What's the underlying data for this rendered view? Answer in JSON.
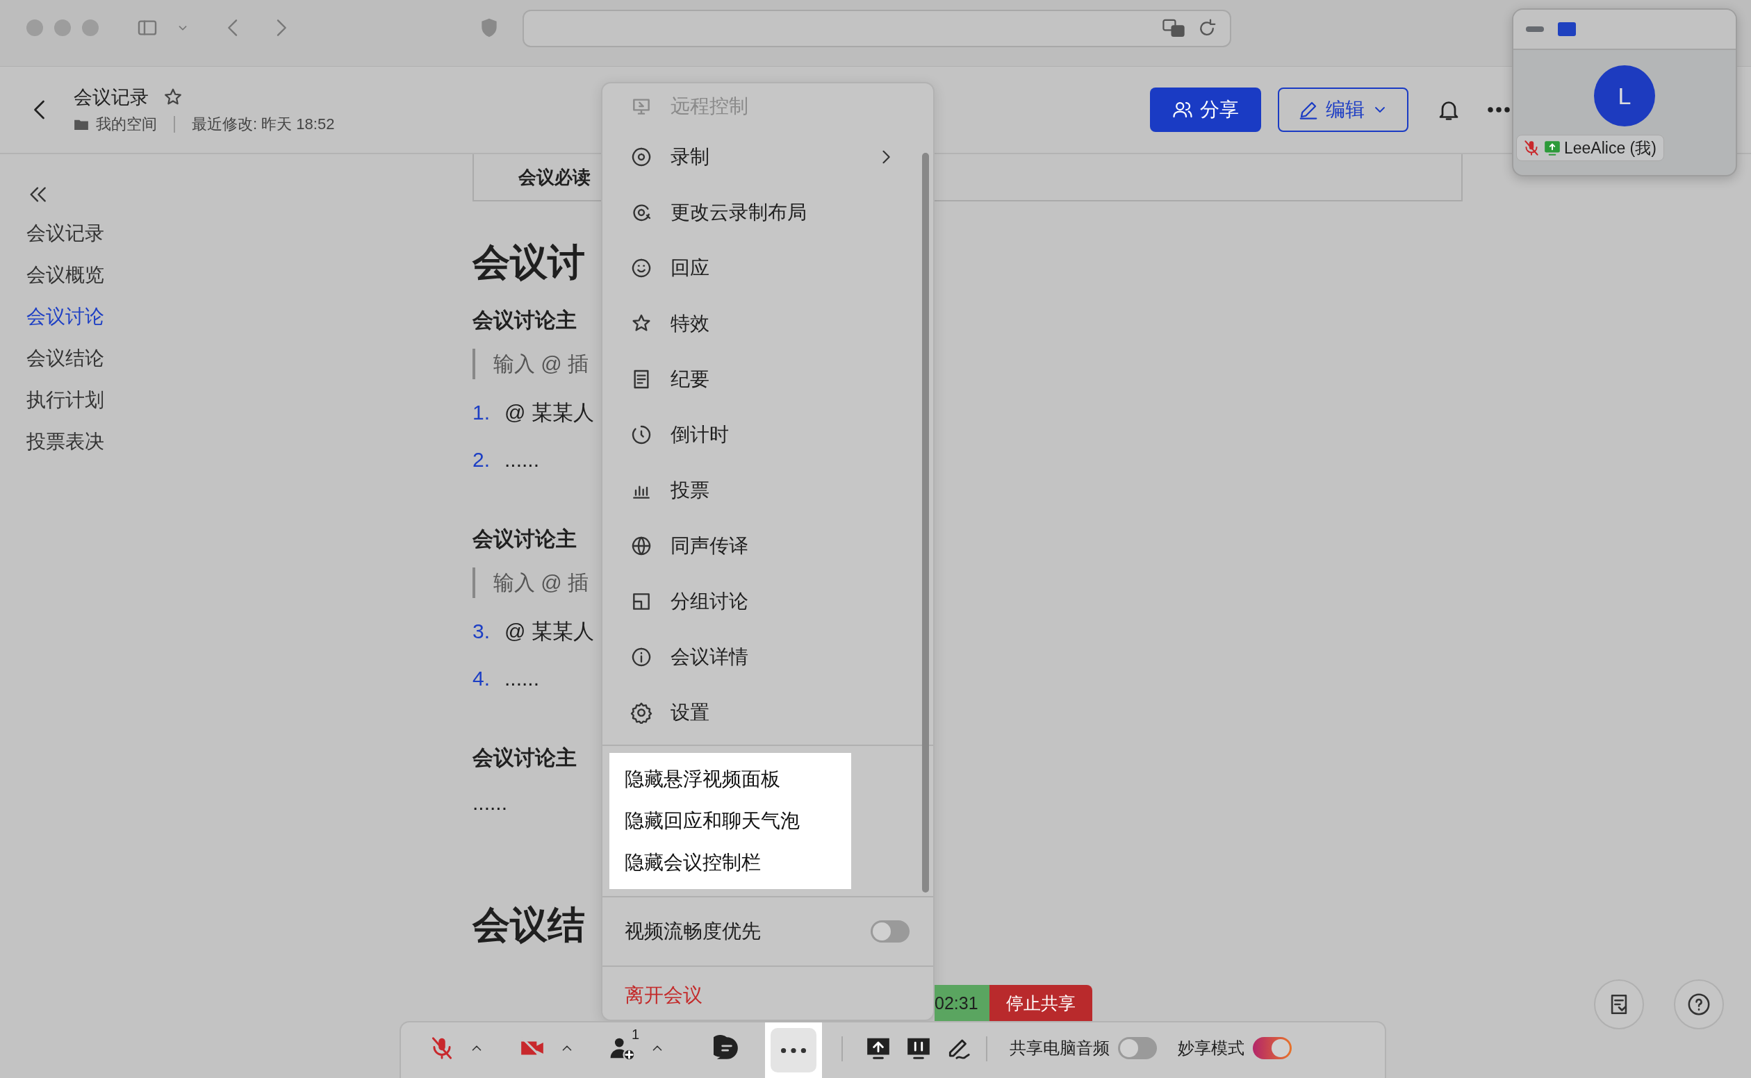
{
  "doc_header": {
    "title": "会议记录",
    "space": "我的空间",
    "modified": "最近修改: 昨天 18:52",
    "share_button": "分享",
    "edit_button": "编辑"
  },
  "outline": [
    {
      "label": "会议记录",
      "selected": false
    },
    {
      "label": "会议概览",
      "selected": false
    },
    {
      "label": "会议讨论",
      "selected": true
    },
    {
      "label": "会议结论",
      "selected": false
    },
    {
      "label": "执行计划",
      "selected": false
    },
    {
      "label": "投票表决",
      "selected": false
    }
  ],
  "document": {
    "notice": "会议必读",
    "blocks": [
      {
        "kind": "h1",
        "text": "会议讨"
      },
      {
        "kind": "h2",
        "text": "会议讨论主"
      },
      {
        "kind": "quote",
        "text": "输入 @ 插"
      },
      {
        "kind": "li",
        "number": "1.",
        "text": "@ 某某人"
      },
      {
        "kind": "li",
        "number": "2.",
        "text": "......"
      },
      {
        "kind": "h2",
        "text": "会议讨论主"
      },
      {
        "kind": "quote",
        "text": "输入 @ 插"
      },
      {
        "kind": "li",
        "number": "3.",
        "text": "@ 某某人"
      },
      {
        "kind": "li",
        "number": "4.",
        "text": "......"
      },
      {
        "kind": "h2",
        "text": "会议讨论主"
      },
      {
        "kind": "p",
        "text": "......"
      },
      {
        "kind": "h1",
        "text": "会议结"
      }
    ]
  },
  "menu": {
    "items": [
      {
        "label": "远程控制",
        "disabled": true,
        "submenu": false
      },
      {
        "label": "录制",
        "disabled": false,
        "submenu": true
      },
      {
        "label": "更改云录制布局",
        "disabled": false,
        "submenu": false
      },
      {
        "label": "回应",
        "disabled": false,
        "submenu": false
      },
      {
        "label": "特效",
        "disabled": false,
        "submenu": false
      },
      {
        "label": "纪要",
        "disabled": false,
        "submenu": false
      },
      {
        "label": "倒计时",
        "disabled": false,
        "submenu": false
      },
      {
        "label": "投票",
        "disabled": false,
        "submenu": false
      },
      {
        "label": "同声传译",
        "disabled": false,
        "submenu": false
      },
      {
        "label": "分组讨论",
        "disabled": false,
        "submenu": false
      },
      {
        "label": "会议详情",
        "disabled": false,
        "submenu": false
      },
      {
        "label": "设置",
        "disabled": false,
        "submenu": false
      }
    ],
    "hide_options": [
      "隐藏悬浮视频面板",
      "隐藏回应和聊天气泡",
      "隐藏会议控制栏"
    ],
    "toggle": {
      "label": "视频流畅度优先",
      "on": false
    },
    "leave": "离开会议"
  },
  "share_status": {
    "timer": "02:31",
    "stop_button": "停止共享"
  },
  "toolbar": {
    "mic_muted": true,
    "camera_off": true,
    "participant_count": "1",
    "audio_share": {
      "label": "共享电脑音频",
      "on": false
    },
    "magic_share": {
      "label": "妙享模式",
      "on": true
    }
  },
  "video_panel": {
    "avatar": "L",
    "name": "LeeAlice (我)",
    "muted": true
  }
}
